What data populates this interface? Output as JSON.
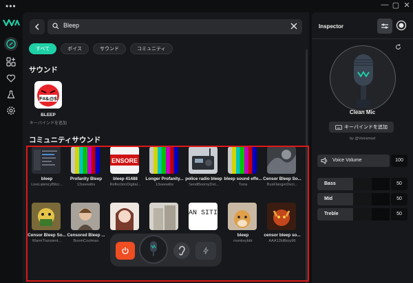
{
  "window": {
    "menu_glyph": "•••",
    "controls": [
      "—",
      "▢",
      "✕"
    ]
  },
  "rail": {
    "items": [
      "voice-changer",
      "soundboard",
      "favorites",
      "lab",
      "settings"
    ]
  },
  "search": {
    "value": "Bleep"
  },
  "filters": [
    {
      "label": "すべて",
      "active": true
    },
    {
      "label": "ボイス",
      "active": false
    },
    {
      "label": "サウンド",
      "active": false
    },
    {
      "label": "コミュニティ",
      "active": false
    }
  ],
  "sounds": {
    "title": "サウンド",
    "item": {
      "name": "BLEEP",
      "sub": "キーバインドを追加",
      "art_text": "F#&@$"
    }
  },
  "community": {
    "title": "コミュニティサウンド",
    "items": [
      {
        "name": "bleep",
        "sub": "LiveLatencyBitcr..."
      },
      {
        "name": "Profanity Bleep",
        "sub": "13seewibs"
      },
      {
        "name": "bleep 41488",
        "sub": "ReflectionDigital..."
      },
      {
        "name": "Longer Profanity...",
        "sub": "13seewibs"
      },
      {
        "name": "police radio bleep",
        "sub": "SendBoomyDet..."
      },
      {
        "name": "bleep sound effe...",
        "sub": "Tuna"
      },
      {
        "name": "Censor Bleep So...",
        "sub": "BusFlangerDeci..."
      },
      {
        "name": "Censor Bleep So...",
        "sub": "WarmTransient..."
      },
      {
        "name": "Censored Bleep ...",
        "sub": "BoomCoolman"
      },
      {
        "name": "c...",
        "sub": ""
      },
      {
        "name": "",
        "sub": ""
      },
      {
        "name": "",
        "sub": ""
      },
      {
        "name": "bleep",
        "sub": "monkeybttr"
      },
      {
        "name": "censor bleep so...",
        "sub": "AAA12killboy96"
      }
    ],
    "censor_text": "ENSORE",
    "transition_text": "TRAN SITION"
  },
  "inspector": {
    "title": "Inspector",
    "voice_name": "Clean Mic",
    "keybind_label": "キーバインドを追加",
    "byline": "by @Voicemod",
    "voice_volume": {
      "label": "Voice Volume",
      "value": "100"
    },
    "eq": [
      {
        "label": "Bass",
        "value": "50"
      },
      {
        "label": "Mid",
        "value": "50"
      },
      {
        "label": "Treble",
        "value": "50"
      }
    ]
  },
  "colors": {
    "accent": "#1fd0a6",
    "power": "#ef4d22",
    "highlight_box": "#e01818"
  }
}
